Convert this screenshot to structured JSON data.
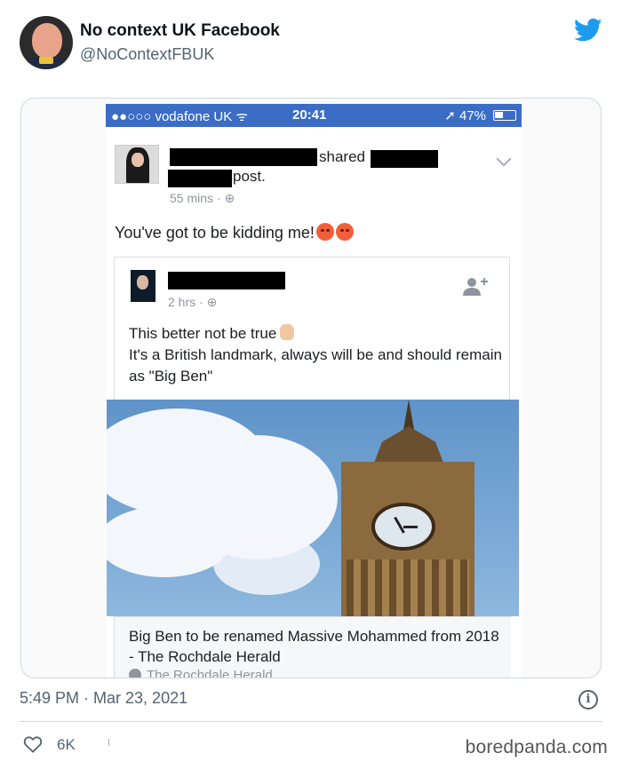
{
  "tweet": {
    "display_name": "No context UK Facebook",
    "handle": "@NoContextFBUK",
    "timestamp": "5:49 PM · Mar 23, 2021",
    "likes": "6K",
    "info_glyph": "i",
    "watermark": "boredpanda.com"
  },
  "phone": {
    "carrier": "●●○○○ vodafone UK ᯤ",
    "time": "20:41",
    "battery": "➚ 47%",
    "battery_fraction": 0.47
  },
  "fb_post": {
    "shared_label": "shared",
    "post_label": "post.",
    "meta": "55 mins · ⊕",
    "body": "You've got to be kidding me!"
  },
  "inner_post": {
    "meta": "2 hrs · ⊕",
    "line1": "This better not be true",
    "line2": "It's a British landmark, always will be and should remain as \"Big Ben\""
  },
  "link": {
    "title": "Big Ben to be renamed Massive Mohammed from 2018 - The Rochdale Herald",
    "source": "The Rochdale Herald"
  },
  "colors": {
    "twitter_blue": "#1d9bf0",
    "status_bar": "#3b6cc6",
    "text_secondary": "#536471"
  },
  "icons": [
    "twitter-bird-icon",
    "chevron-down-icon",
    "add-friend-icon",
    "globe-icon",
    "info-icon",
    "heart-icon",
    "angry-emoji-icon",
    "raised-hand-emoji-icon"
  ]
}
